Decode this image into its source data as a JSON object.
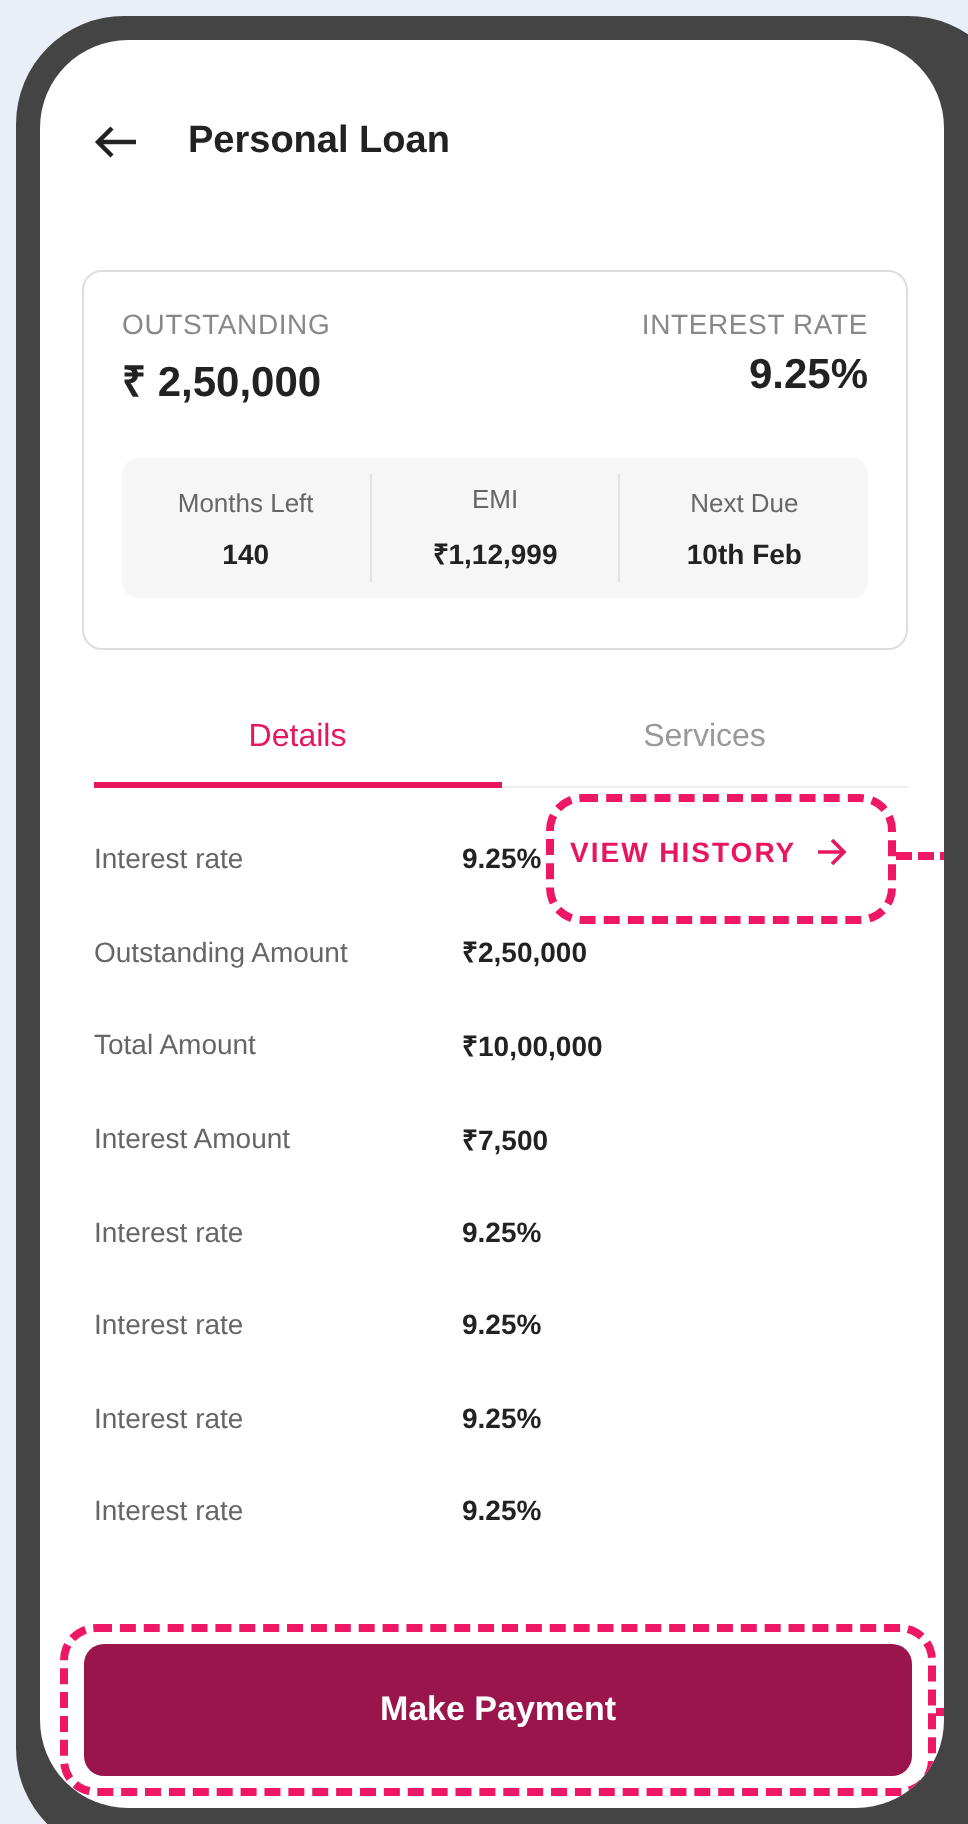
{
  "header": {
    "title": "Personal Loan"
  },
  "summary": {
    "outstanding_label": "OUTSTANDING",
    "outstanding_value": "₹ 2,50,000",
    "rate_label": "INTEREST RATE",
    "rate_value": "9.25%",
    "stats": [
      {
        "label": "Months Left",
        "value": "140"
      },
      {
        "label": "EMI",
        "value": "₹1,12,999"
      },
      {
        "label": "Next Due",
        "value": "10th Feb"
      }
    ]
  },
  "tabs": [
    {
      "label": "Details",
      "selected": true
    },
    {
      "label": "Services",
      "selected": false
    }
  ],
  "details": [
    {
      "label": "Interest rate",
      "value": "9.25%"
    },
    {
      "label": "Outstanding Amount",
      "value": "₹2,50,000"
    },
    {
      "label": "Total Amount",
      "value": "₹10,00,000"
    },
    {
      "label": "Interest Amount",
      "value": "₹7,500"
    },
    {
      "label": "Interest rate",
      "value": "9.25%"
    },
    {
      "label": "Interest rate",
      "value": "9.25%"
    },
    {
      "label": "Interest rate",
      "value": "9.25%"
    },
    {
      "label": "Interest rate",
      "value": "9.25%"
    }
  ],
  "view_history": {
    "label": "VIEW HISTORY",
    "highlighted": true
  },
  "make_payment": {
    "label": "Make Payment",
    "highlighted": true
  }
}
